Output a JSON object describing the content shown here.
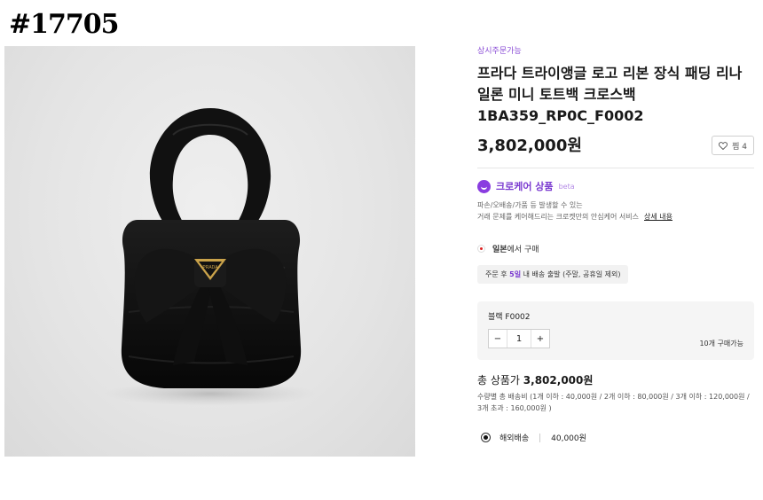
{
  "listing_id": "#17705",
  "product": {
    "order_tag": "상시주문가능",
    "title": "프라다 트라이앵글 로고 리본 장식 패딩 리나일론 미니 토트백 크로스백 1BA359_RP0C_F0002",
    "price": "3,802,000원",
    "like_label": "찜 4",
    "logo_text": "PRADA"
  },
  "care": {
    "title": "크로케어 상품",
    "beta": "beta",
    "desc_line1": "파손/오배송/가품 등 발생할 수 있는",
    "desc_line2": "거래 문제를 케어해드리는 크로켓만의 안심케어 서비스",
    "link": "상세 내용"
  },
  "origin": {
    "country": "일본",
    "suffix": "에서 구매",
    "ship_prefix": "주문 후 ",
    "ship_days": "5일",
    "ship_suffix": " 내 배송 출발 (주말, 공휴일 제외)"
  },
  "option": {
    "name": "블랙 F0002",
    "minus": "−",
    "qty": "1",
    "plus": "+",
    "stock": "10개 구매가능"
  },
  "total": {
    "label": "총 상품가 ",
    "amount": "3,802,000원",
    "desc_line1": "수량별 총 배송비 (1개 이하 : 40,000원 / 2개 이하 : 80,000원 / 3개 이하 : 120,000원 /",
    "desc_line2": "3개 초과 : 160,000원 )"
  },
  "shipping": {
    "method": "해외배송",
    "fee": "40,000원"
  },
  "colors": {
    "accent": "#7a3ad0",
    "bag": "#0d0d0d",
    "logo_gold": "#c9a24a"
  }
}
